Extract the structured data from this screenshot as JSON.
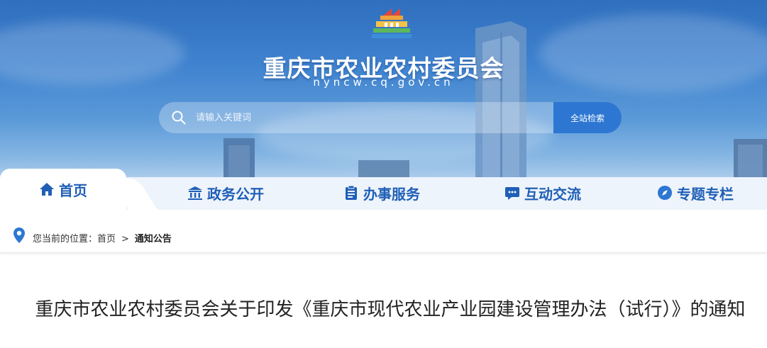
{
  "header": {
    "site_title": "重庆市农业农村委员会",
    "site_domain": "nyncw.cq.gov.cn",
    "logo": "government-building-logo"
  },
  "search": {
    "placeholder": "请输入关键词",
    "value": "",
    "button_label": "全站检索",
    "icon": "search-icon"
  },
  "nav": {
    "tabs": [
      {
        "label": "首页",
        "icon": "home-icon",
        "active": true
      },
      {
        "label": "政务公开",
        "icon": "government-icon",
        "active": false
      },
      {
        "label": "办事服务",
        "icon": "clipboard-icon",
        "active": false
      },
      {
        "label": "互动交流",
        "icon": "chat-icon",
        "active": false
      },
      {
        "label": "专题专栏",
        "icon": "compass-icon",
        "active": false
      }
    ]
  },
  "breadcrumb": {
    "prefix": "您当前的位置：首页",
    "separator": ">",
    "current": "通知公告",
    "icon": "location-pin-icon"
  },
  "article": {
    "title": "重庆市农业农村委员会关于印发《重庆市现代农业产业园建设管理办法（试行）》的通知"
  },
  "colors": {
    "brand_blue": "#1f5fb6",
    "search_button": "#2d77d2",
    "nav_background": "#eef4fb"
  }
}
